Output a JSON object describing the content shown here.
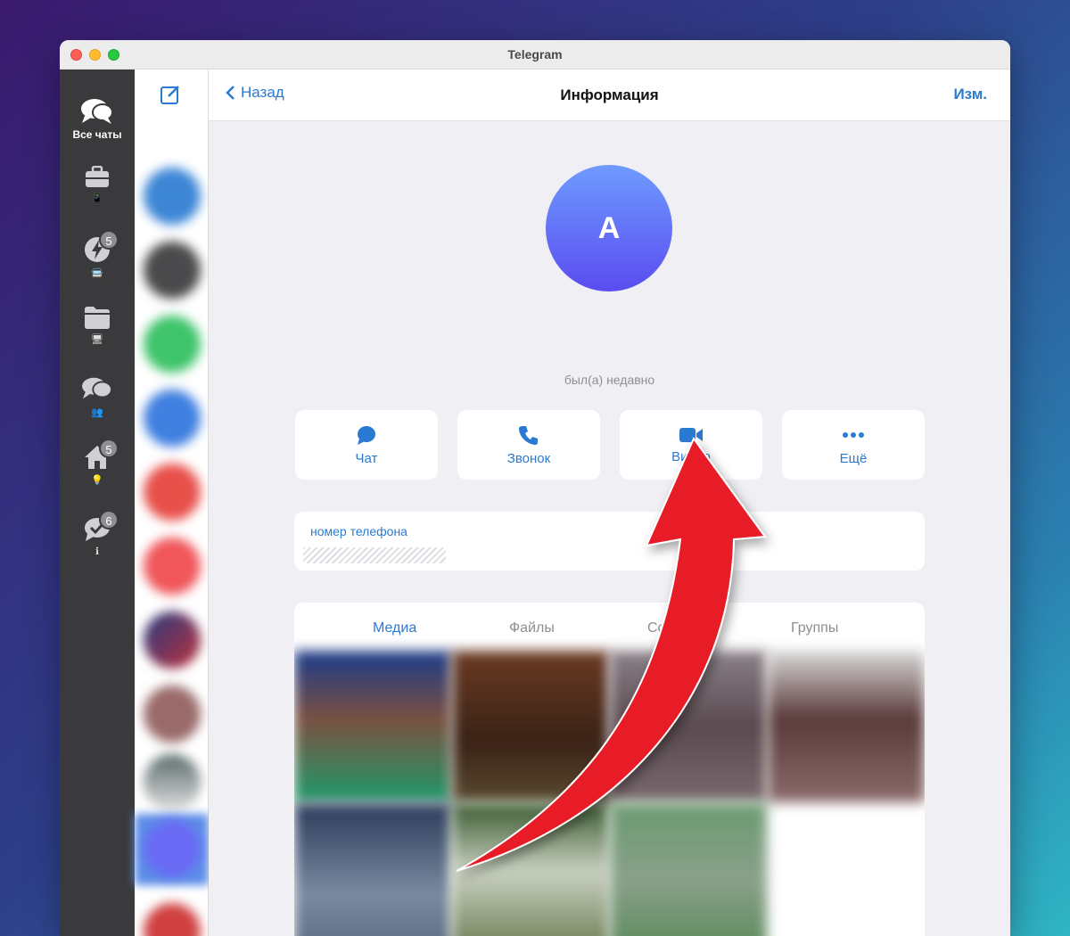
{
  "window": {
    "title": "Telegram"
  },
  "rail": {
    "items": [
      {
        "label": "Все чаты",
        "icon": "chat-bubbles-icon",
        "badge": ""
      },
      {
        "label": "",
        "icon": "briefcase-icon",
        "emoji": "📱",
        "badge": ""
      },
      {
        "label": "",
        "icon": "lightning-icon",
        "emoji": "🚍",
        "badge": "5"
      },
      {
        "label": "",
        "icon": "folder-icon",
        "emoji": "🖥",
        "badge": ""
      },
      {
        "label": "",
        "icon": "chat-bubbles-icon",
        "emoji": "👥",
        "badge": ""
      },
      {
        "label": "",
        "icon": "home-icon",
        "emoji": "💡",
        "badge": "5"
      },
      {
        "label": "",
        "icon": "checkmark-bubble-icon",
        "emoji": "ℹ",
        "badge": "6"
      }
    ]
  },
  "nav": {
    "back_label": "Назад",
    "title": "Информация",
    "edit_label": "Изм."
  },
  "profile": {
    "initial": "А",
    "status": "был(а) недавно"
  },
  "actions": [
    {
      "label": "Чат",
      "icon": "chat-icon"
    },
    {
      "label": "Звонок",
      "icon": "phone-icon"
    },
    {
      "label": "Видео",
      "icon": "video-camera-icon"
    },
    {
      "label": "Ещё",
      "icon": "more-dots-icon"
    }
  ],
  "phone": {
    "label": "номер телефона"
  },
  "media_tabs": [
    {
      "label": "Медиа",
      "active": true
    },
    {
      "label": "Файлы",
      "active": false
    },
    {
      "label": "Ссыл",
      "active": false
    },
    {
      "label": "Группы",
      "active": false
    }
  ],
  "colors": {
    "accent": "#2a7ad1",
    "arrow": "#e81e25"
  }
}
